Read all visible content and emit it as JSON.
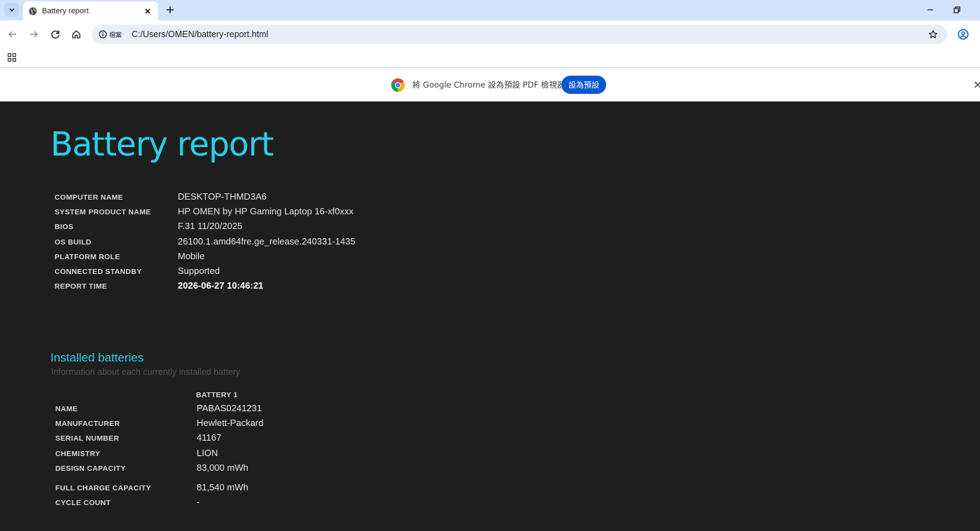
{
  "browser": {
    "tab_title": "Battery report",
    "site_chip": "檔案",
    "url": "C:/Users/OMEN/battery-report.html"
  },
  "infobar": {
    "message": "將 Google Chrome 設為預設 PDF 檢視器",
    "button": "設為預設",
    "close": "×"
  },
  "report": {
    "title": "Battery report",
    "system": [
      {
        "label": "COMPUTER NAME",
        "value": "DESKTOP-THMD3A6"
      },
      {
        "label": "SYSTEM PRODUCT NAME",
        "value": "HP OMEN by HP Gaming Laptop 16-xf0xxx"
      },
      {
        "label": "BIOS",
        "value": "F.31 11/20/2025"
      },
      {
        "label": "OS BUILD",
        "value": "26100.1.amd64fre.ge_release.240331-1435"
      },
      {
        "label": "PLATFORM ROLE",
        "value": "Mobile"
      },
      {
        "label": "CONNECTED STANDBY",
        "value": "Supported"
      },
      {
        "label": "REPORT TIME",
        "value": "2026-06-27  10:46:21"
      }
    ],
    "installed": {
      "title": "Installed batteries",
      "subtitle": "Information about each currently installed battery",
      "column": "BATTERY 1",
      "rows": [
        {
          "label": "NAME",
          "value": "PABAS0241231"
        },
        {
          "label": "MANUFACTURER",
          "value": "Hewlett-Packard"
        },
        {
          "label": "SERIAL NUMBER",
          "value": "41167"
        },
        {
          "label": "CHEMISTRY",
          "value": "LION"
        },
        {
          "label": "DESIGN CAPACITY",
          "value": "83,000 mWh"
        },
        {
          "label": "FULL CHARGE CAPACITY",
          "value": "81,540 mWh"
        },
        {
          "label": "CYCLE COUNT",
          "value": "-"
        }
      ]
    }
  }
}
